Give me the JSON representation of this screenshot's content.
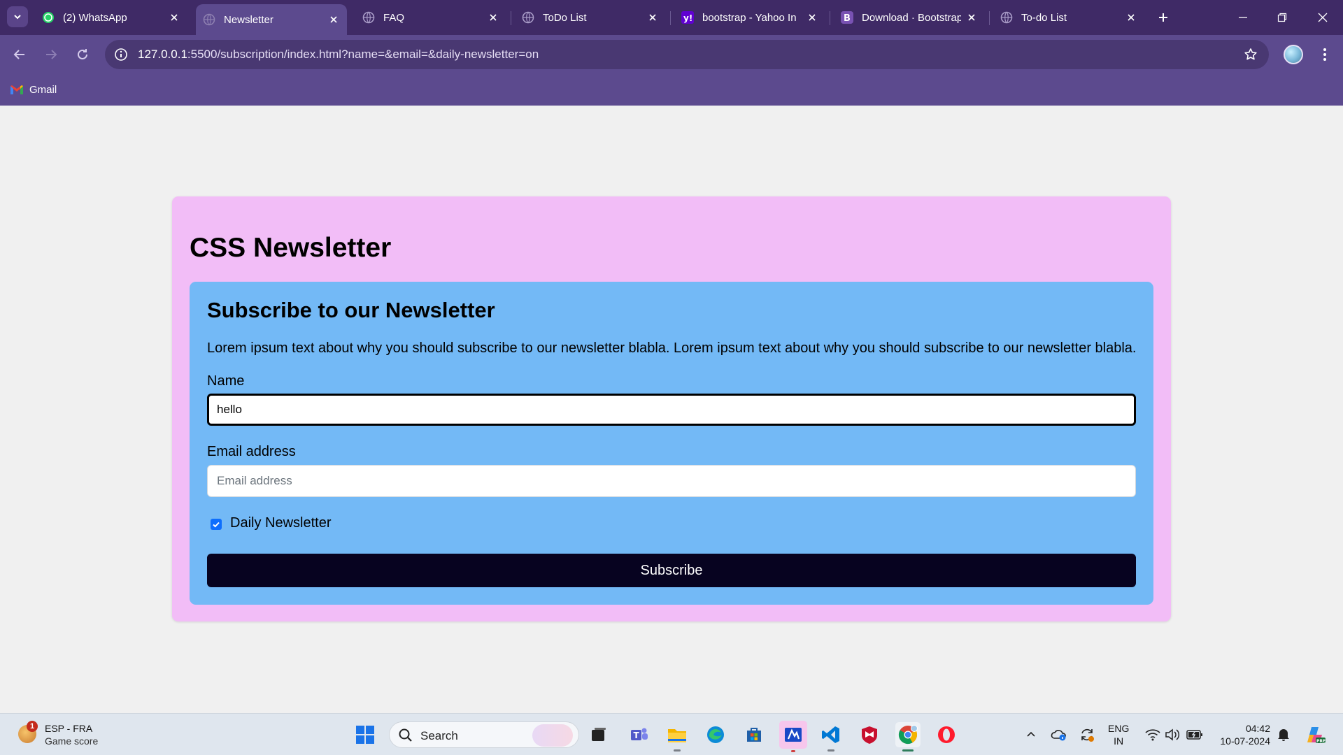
{
  "browser": {
    "tabs": [
      {
        "title": "(2) WhatsApp",
        "icon": "whatsapp-icon",
        "active": false
      },
      {
        "title": "Newsletter",
        "icon": "globe-icon",
        "active": true
      },
      {
        "title": "FAQ",
        "icon": "globe-icon",
        "active": false
      },
      {
        "title": "ToDo List",
        "icon": "globe-icon",
        "active": false
      },
      {
        "title": "bootstrap - Yahoo In",
        "icon": "yahoo-icon",
        "active": false
      },
      {
        "title": "Download · Bootstrap",
        "icon": "bootstrap-icon",
        "active": false
      },
      {
        "title": "To-do List",
        "icon": "globe-icon",
        "active": false
      }
    ],
    "url_host": "127.0.0.1",
    "url_rest": ":5500/subscription/index.html?name=&email=&daily-newsletter=on",
    "bookmarks": [
      {
        "label": "Gmail",
        "icon": "gmail-icon"
      }
    ],
    "colors": {
      "tabbar": "#3f2a66",
      "toolbar": "#5c4a8e"
    }
  },
  "page": {
    "title": "CSS Newsletter",
    "form": {
      "heading": "Subscribe to our Newsletter",
      "description": "Lorem ipsum text about why you should subscribe to our newsletter blabla. Lorem ipsum text about why you should subscribe to our newsletter blabla.",
      "name_label": "Name",
      "name_value": "hello",
      "email_label": "Email address",
      "email_placeholder": "Email address",
      "checkbox_label": "Daily Newsletter",
      "checkbox_checked": true,
      "submit_label": "Subscribe"
    },
    "colors": {
      "outer_card": "#f2bdf7",
      "inner_card": "#73b9f6",
      "button": "#070320",
      "background": "#f0f0f0"
    }
  },
  "taskbar": {
    "widget": {
      "badge": "1",
      "line1": "ESP - FRA",
      "line2": "Game score"
    },
    "search_label": "Search",
    "pinned": [
      "windows-start-icon",
      "search",
      "task-view-icon",
      "teams-icon",
      "file-explorer-icon",
      "edge-icon",
      "microsoft-store-icon",
      "app-icon",
      "vscode-icon",
      "mcafee-icon",
      "chrome-icon",
      "opera-icon"
    ],
    "tray": {
      "lang_line1": "ENG",
      "lang_line2": "IN"
    },
    "clock": {
      "time": "04:42",
      "date": "10-07-2024"
    }
  }
}
